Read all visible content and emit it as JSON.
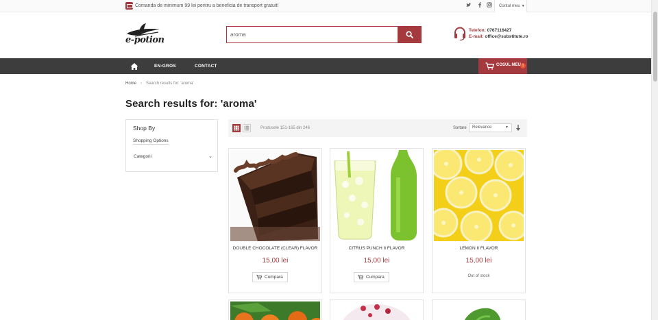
{
  "topbar": {
    "promo_text": "Comanda de minimum 99 lei pentru a beneficia de transport gratuit!",
    "account_label": "Contul meu"
  },
  "header": {
    "logo_text": "e-potion",
    "search": {
      "value": "aroma",
      "placeholder": ""
    },
    "phone_label": "Telefon:",
    "phone": "0767116427",
    "email_label": "E-mail:",
    "email": "office@substitute.ro"
  },
  "nav": {
    "items": [
      {
        "label": "EN-GROS"
      },
      {
        "label": "CONTACT"
      }
    ],
    "cart_label": "COSUL MEU",
    "cart_count": "1"
  },
  "breadcrumbs": {
    "home": "Home",
    "current": "Search results for: 'aroma'"
  },
  "page_title": "Search results for: 'aroma'",
  "sidebar": {
    "title": "Shop By",
    "options_label": "Shopping Options",
    "category_label": "Categorii"
  },
  "toolbar": {
    "count_text": "Produsele 151-165 din 246",
    "sort_label": "Sortare",
    "sort_value": "Relevance"
  },
  "products": [
    {
      "name": "DOUBLE CHOCOLATE (CLEAR) FLAVOR",
      "price": "15,00 lei",
      "action": "Cumpara"
    },
    {
      "name": "CITRUS PUNCH II FLAVOR",
      "price": "15,00 lei",
      "action": "Cumpara"
    },
    {
      "name": "LEMON II FLAVOR",
      "price": "15,00 lei",
      "status": "Out of stock"
    }
  ],
  "colors": {
    "brand": "#a43a3e",
    "nav_bg": "#3d3d3d",
    "badge": "#e8522f"
  }
}
